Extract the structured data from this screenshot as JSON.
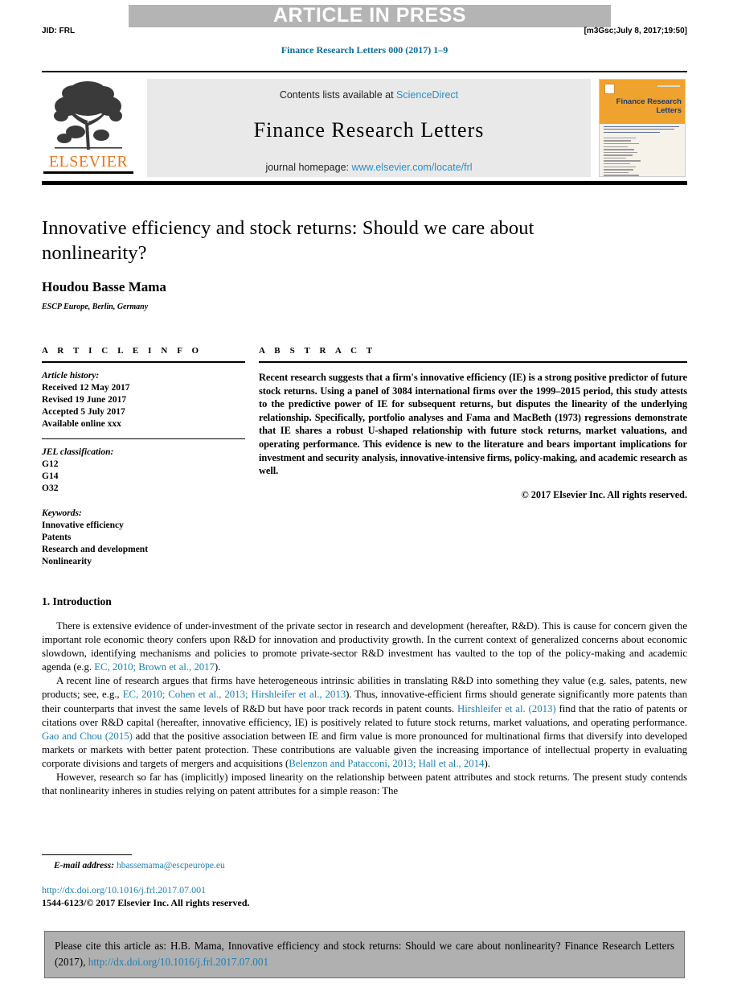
{
  "header": {
    "press_banner": "ARTICLE IN PRESS",
    "jid": "JID: FRL",
    "production_stamp": "[m3Gsc;July 8, 2017;19:50]",
    "journal_reference": "Finance Research Letters 000 (2017) 1–9"
  },
  "masthead": {
    "contents_prefix": "Contents lists available at",
    "contents_link": "ScienceDirect",
    "journal_title": "Finance Research Letters",
    "homepage_prefix": "journal homepage:",
    "homepage_url": "www.elsevier.com/locate/frl",
    "publisher_name": "ELSEVIER",
    "cover_title": "Finance Research Letters"
  },
  "article": {
    "title": "Innovative efficiency and stock returns: Should we care about nonlinearity?",
    "author": "Houdou Basse Mama",
    "affiliation": "ESCP Europe, Berlin, Germany"
  },
  "article_info": {
    "heading": "A R T I C L E   I N F O",
    "history_label": "Article history:",
    "history": [
      "Received 12 May 2017",
      "Revised 19 June 2017",
      "Accepted 5 July 2017",
      "Available online xxx"
    ],
    "jel_label": "JEL classification:",
    "jel_codes": [
      "G12",
      "G14",
      "O32"
    ],
    "keywords_label": "Keywords:",
    "keywords": [
      "Innovative efficiency",
      "Patents",
      "Research and development",
      "Nonlinearity"
    ]
  },
  "abstract": {
    "heading": "A B S T R A C T",
    "text": "Recent research suggests that a firm's innovative efficiency (IE) is a strong positive predictor of future stock returns. Using a panel of 3084 international firms over the 1999–2015 period, this study attests to the predictive power of IE for subsequent returns, but disputes the linearity of the underlying relationship. Specifically, portfolio analyses and Fama and MacBeth (1973) regressions demonstrate that IE shares a robust U-shaped relationship with future stock returns, market valuations, and operating performance. This evidence is new to the literature and bears important implications for investment and security analysis, innovative-intensive firms, policy-making, and academic research as well.",
    "copyright": "© 2017 Elsevier Inc. All rights reserved."
  },
  "introduction": {
    "heading": "1. Introduction",
    "paragraph_1_a": "There is extensive evidence of under-investment of the private sector in research and development (hereafter, R&D). This is cause for concern given the important role economic theory confers upon R&D for innovation and productivity growth. In the current context of generalized concerns about economic slowdown, identifying mechanisms and policies to promote private-sector R&D investment has vaulted to the top of the policy-making and academic agenda (e.g. ",
    "paragraph_1_cite": "EC, 2010; Brown et al., 2017",
    "paragraph_1_b": ").",
    "paragraph_2_a": "A recent line of research argues that firms have heterogeneous intrinsic abilities in translating R&D into something they value (e.g. sales, patents, new products; see, e.g., ",
    "paragraph_2_cite1": "EC, 2010; Cohen et al., 2013; Hirshleifer et al., 2013",
    "paragraph_2_b": "). Thus, innovative-efficient firms should generate significantly more patents than their counterparts that invest the same levels of R&D but have poor track records in patent counts. ",
    "paragraph_2_cite2": "Hirshleifer et al. (2013)",
    "paragraph_2_c": " find that the ratio of patents or citations over R&D capital (hereafter, innovative efficiency, IE) is positively related to future stock returns, market valuations, and operating performance. ",
    "paragraph_2_cite3": "Gao and Chou (2015)",
    "paragraph_2_d": " add that the positive association between IE and firm value is more pronounced for multinational firms that diversify into developed markets or markets with better patent protection. These contributions are valuable given the increasing importance of intellectual property in evaluating corporate divisions and targets of mergers and acquisitions (",
    "paragraph_2_cite4": "Belenzon and Patacconi, 2013; Hall et al., 2014",
    "paragraph_2_e": ").",
    "paragraph_3": "However, research so far has (implicitly) imposed linearity on the relationship between patent attributes and stock returns. The present study contends that nonlinearity inheres in studies relying on patent attributes for a simple reason: The"
  },
  "footnote": {
    "email_label": "E-mail address:",
    "email": "hbassemama@escpeurope.eu",
    "doi": "http://dx.doi.org/10.1016/j.frl.2017.07.001",
    "issn_copyright": "1544-6123/© 2017 Elsevier Inc. All rights reserved."
  },
  "cite_box": {
    "text_a": "Please cite this article as: H.B. Mama, Innovative efficiency and stock returns: Should we care about nonlinearity? Finance Research Letters (2017), ",
    "link": "http://dx.doi.org/10.1016/j.frl.2017.07.001"
  },
  "colors": {
    "link_blue": "#1b7fb5",
    "sciencedirect_blue": "#2a8ec9",
    "elsevier_orange": "#e87722",
    "cover_orange": "#f0a22e",
    "banner_gray": "#b4b4b4",
    "cite_box_gray": "#b0b0b0"
  }
}
